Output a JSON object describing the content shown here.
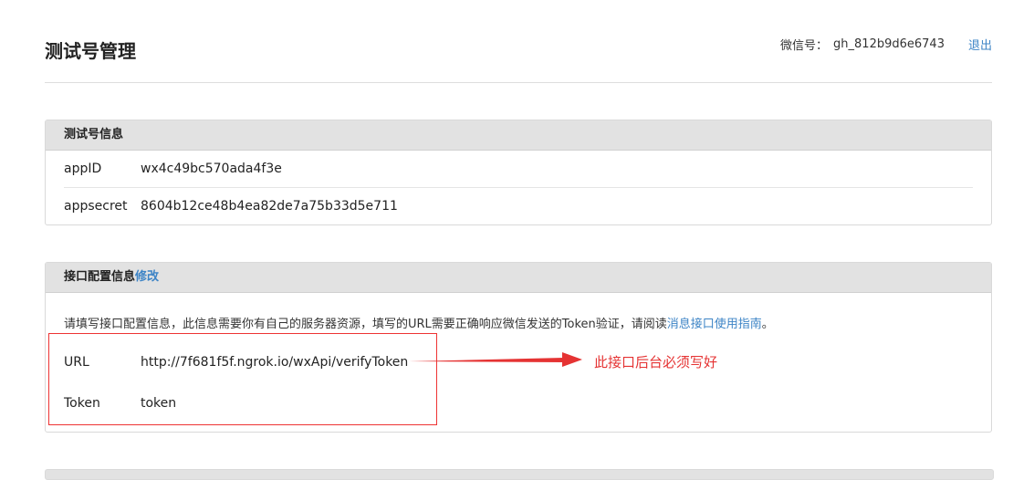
{
  "page": {
    "title": "测试号管理",
    "wechat_label": "微信号：",
    "wechat_id": "gh_812b9d6e6743",
    "logout_label": "退出"
  },
  "test_account": {
    "header": "测试号信息",
    "rows": [
      {
        "key": "appID",
        "value": "wx4c49bc570ada4f3e"
      },
      {
        "key": "appsecret",
        "value": "8604b12ce48b4ea82de7a75b33d5e711"
      }
    ]
  },
  "interface_config": {
    "header": "接口配置信息",
    "edit_label": "修改",
    "notice_text": "请填写接口配置信息，此信息需要你有自己的服务器资源，填写的URL需要正确响应微信发送的Token验证，请阅读",
    "notice_link": "消息接口使用指南",
    "notice_end": "。",
    "url_label": "URL",
    "url_value": "http://7f681f5f.ngrok.io/wxApi/verifyToken",
    "token_label": "Token",
    "token_value": "token"
  },
  "annotation": {
    "text": "此接口后台必须写好",
    "color": "#e53333"
  }
}
